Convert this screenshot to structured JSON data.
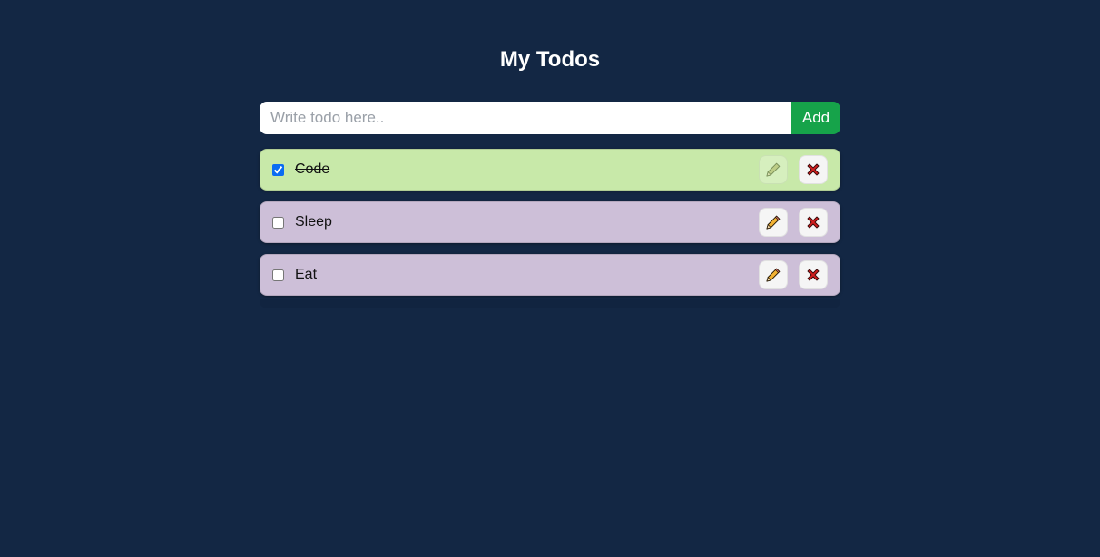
{
  "app": {
    "title": "My Todos"
  },
  "form": {
    "input_placeholder": "Write todo here..",
    "input_value": "",
    "add_label": "Add"
  },
  "colors": {
    "background": "#132744",
    "add_button": "#16a34a",
    "done_item": "#c8e9a9",
    "pending_item": "#cdbfd8",
    "delete_icon": "#d21f1f",
    "edit_icon": "#f2b233"
  },
  "todos": [
    {
      "text": "Code",
      "completed": true,
      "edit_icon": "pencil-icon",
      "delete_icon": "x-icon"
    },
    {
      "text": "Sleep",
      "completed": false,
      "edit_icon": "pencil-icon",
      "delete_icon": "x-icon"
    },
    {
      "text": "Eat",
      "completed": false,
      "edit_icon": "pencil-icon",
      "delete_icon": "x-icon"
    }
  ]
}
